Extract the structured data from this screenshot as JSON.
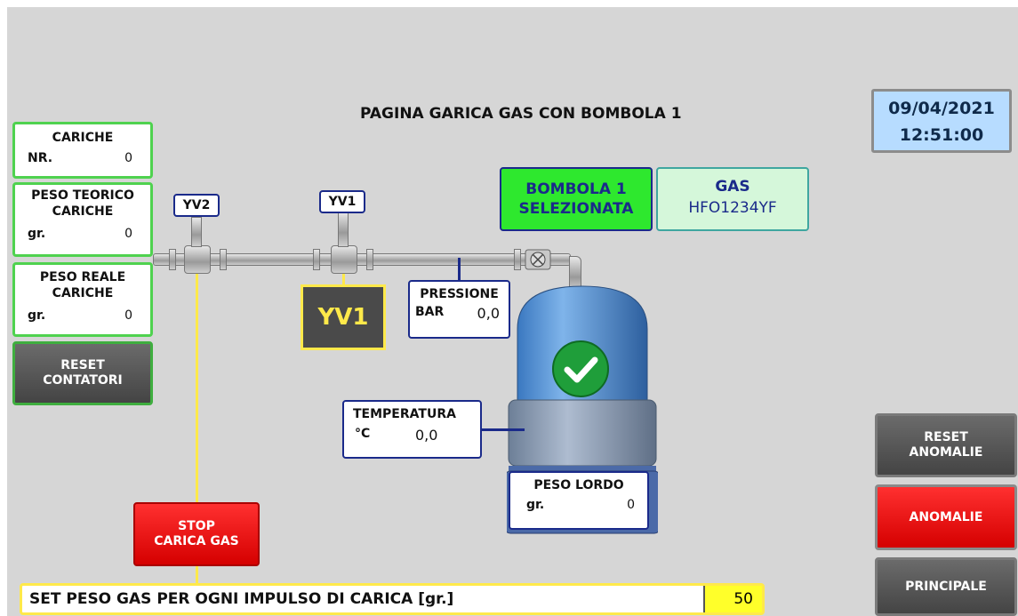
{
  "page_title": "PAGINA GARICA GAS CON BOMBOLA 1",
  "datetime": {
    "date": "09/04/2021",
    "time": "12:51:00"
  },
  "counters": {
    "cariche": {
      "title": "CARICHE",
      "label": "NR.",
      "value": "0"
    },
    "peso_teorico": {
      "title_line1": "PESO TEORICO",
      "title_line2": "CARICHE",
      "label": "gr.",
      "value": "0"
    },
    "peso_reale": {
      "title_line1": "PESO REALE",
      "title_line2": "CARICHE",
      "label": "gr.",
      "value": "0"
    }
  },
  "buttons": {
    "reset_contatori": {
      "line1": "RESET",
      "line2": "CONTATORI"
    },
    "stop_carica": {
      "line1": "STOP",
      "line2": "CARICA GAS"
    },
    "reset_anomalie": {
      "line1": "RESET",
      "line2": "ANOMALIE"
    },
    "anomalie": "ANOMALIE",
    "principale": "PRINCIPALE"
  },
  "valves": {
    "yv2": "YV2",
    "yv1": "YV1",
    "yv1_status": "YV1"
  },
  "bombola": {
    "line1": "BOMBOLA 1",
    "line2": "SELEZIONATA"
  },
  "gas": {
    "title": "GAS",
    "value": "HFO1234YF"
  },
  "pressione": {
    "title": "PRESSIONE",
    "label": "BAR",
    "value": "0,0"
  },
  "temperatura": {
    "title": "TEMPERATURA",
    "label": "°C",
    "value": "0,0"
  },
  "peso_lordo": {
    "title": "PESO LORDO",
    "label": "gr.",
    "value": "0"
  },
  "set_peso": {
    "label": "SET PESO GAS PER OGNI IMPULSO DI CARICA [gr.]",
    "value": "50"
  },
  "colors": {
    "accent_green": "#4fd24f",
    "selected_green": "#2ee82e",
    "alarm_red": "#ff1a1a",
    "tank_blue": "#4a90d9",
    "date_bg": "#b7dcff"
  }
}
